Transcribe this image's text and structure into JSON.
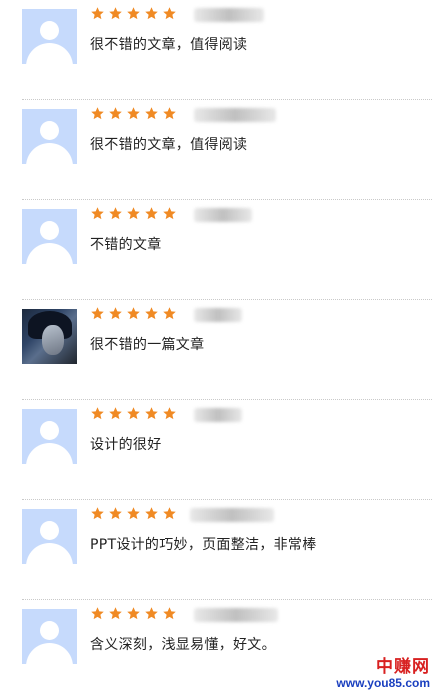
{
  "reviews": [
    {
      "rating": 5,
      "avatar": "default-avatar-icon",
      "comment": "很不错的文章，值得阅读"
    },
    {
      "rating": 5,
      "avatar": "default-avatar-icon",
      "comment": "很不错的文章，值得阅读"
    },
    {
      "rating": 5,
      "avatar": "default-avatar-icon",
      "comment": "不错的文章"
    },
    {
      "rating": 5,
      "avatar": "user-photo-avatar",
      "comment": "很不错的一篇文章"
    },
    {
      "rating": 5,
      "avatar": "default-avatar-icon",
      "comment": "设计的很好"
    },
    {
      "rating": 5,
      "avatar": "default-avatar-icon",
      "comment": "PPT设计的巧妙，页面整洁，非常棒"
    },
    {
      "rating": 5,
      "avatar": "default-avatar-icon",
      "comment": "含义深刻，浅显易懂，好文。"
    }
  ],
  "colors": {
    "star": "#f08a24",
    "avatar_bg": "#c6dafc",
    "divider": "#c9c9c9"
  },
  "watermark": {
    "name": "中赚网",
    "url": "www.you85.com"
  }
}
